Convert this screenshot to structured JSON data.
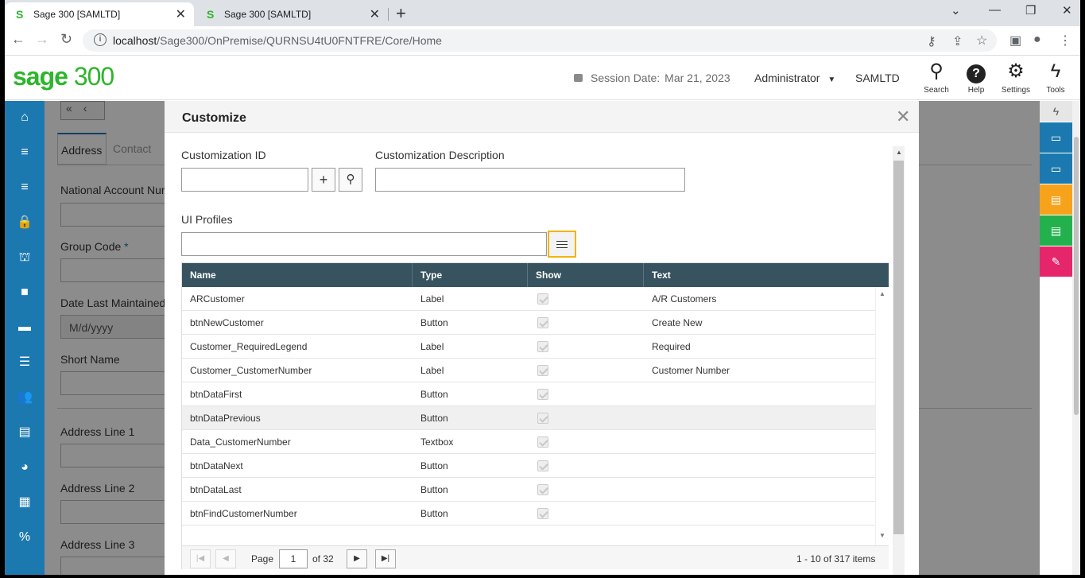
{
  "browser": {
    "tabs": [
      {
        "favicon": "S",
        "title": "Sage 300 [SAMLTD]",
        "active": true
      },
      {
        "favicon": "S",
        "title": "Sage 300 [SAMLTD]",
        "active": false
      }
    ],
    "url_host": "localhost",
    "url_path": "/Sage300/OnPremise/QURNSU4tU0FNTFRE/Core/Home"
  },
  "header": {
    "logo_bold": "sage",
    "logo_num": " 300",
    "session_label": "Session Date:",
    "session_date": "Mar 21, 2023",
    "user": "Administrator",
    "company": "SAMLTD",
    "icons": [
      {
        "name": "search",
        "label": "Search"
      },
      {
        "name": "help",
        "label": "Help"
      },
      {
        "name": "settings",
        "label": "Settings"
      },
      {
        "name": "tools",
        "label": "Tools"
      }
    ]
  },
  "background": {
    "tabs": [
      "Address",
      "Contact"
    ],
    "labels": [
      "National Account Num",
      "Group Code",
      "Date Last Maintained",
      "Short Name",
      "Address Line 1",
      "Address Line 2",
      "Address Line 3"
    ],
    "required_mark": "*",
    "date_placeholder": "M/d/yyyy"
  },
  "modal": {
    "title": "Customize",
    "customization_id_label": "Customization ID",
    "customization_desc_label": "Customization Description",
    "ui_profiles_label": "UI Profiles",
    "columns": [
      "Name",
      "Type",
      "Show",
      "Text"
    ],
    "rows": [
      {
        "name": "ARCustomer",
        "type": "Label",
        "text": "A/R Customers"
      },
      {
        "name": "btnNewCustomer",
        "type": "Button",
        "text": "Create New"
      },
      {
        "name": "Customer_RequiredLegend",
        "type": "Label",
        "text": "Required"
      },
      {
        "name": "Customer_CustomerNumber",
        "type": "Label",
        "text": "Customer Number"
      },
      {
        "name": "btnDataFirst",
        "type": "Button",
        "text": ""
      },
      {
        "name": "btnDataPrevious",
        "type": "Button",
        "text": ""
      },
      {
        "name": "Data_CustomerNumber",
        "type": "Textbox",
        "text": ""
      },
      {
        "name": "btnDataNext",
        "type": "Button",
        "text": ""
      },
      {
        "name": "btnDataLast",
        "type": "Button",
        "text": ""
      },
      {
        "name": "btnFindCustomerNumber",
        "type": "Button",
        "text": ""
      }
    ],
    "pager": {
      "page_label": "Page",
      "page": "1",
      "of_label": "of 32",
      "summary": "1 - 10 of 317 items"
    }
  },
  "colors": {
    "sage_green": "#2db52b",
    "nav_blue": "#1c79b0",
    "grid_header": "#36535f",
    "highlight": "#f0b400"
  }
}
